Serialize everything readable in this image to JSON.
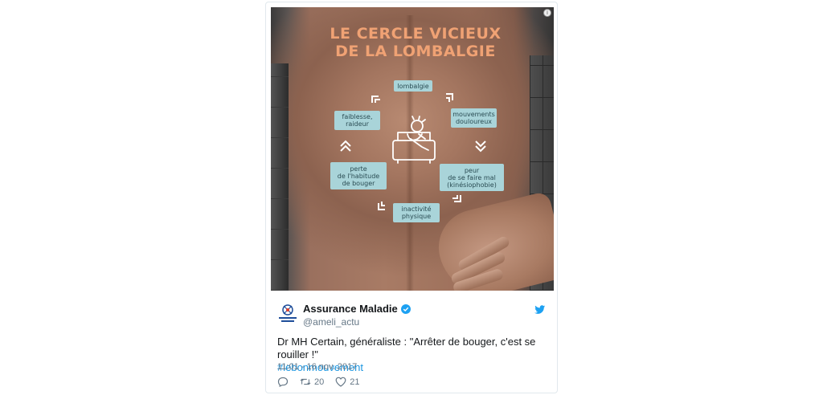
{
  "infographic": {
    "title_line1": "LE CERCLE VICIEUX",
    "title_line2": "DE LA LOMBALGIE",
    "info_badge": "i",
    "cycle": {
      "lombalgie": "lombalgie",
      "mouvements_line1": "mouvements",
      "mouvements_line2": "douloureux",
      "peur_line1": "peur",
      "peur_line2": "de se faire mal",
      "peur_line3": "(kinésiophobie)",
      "inactivite_line1": "inactivité",
      "inactivite_line2": "physique",
      "perte_line1": "perte",
      "perte_line2": "de l'habitude",
      "perte_line3": "de bouger",
      "faiblesse_line1": "faiblesse,",
      "faiblesse_line2": "raideur"
    },
    "colors": {
      "title": "#f0a274",
      "box_fill": "#a9d4d9",
      "box_text": "#2a4c53"
    }
  },
  "tweet": {
    "author_name": "Assurance Maladie",
    "handle": "@ameli_actu",
    "text": "Dr MH Certain, généraliste : \"Arrêter de bouger, c'est se rouiller !\"",
    "hashtag": "#lebonmouvement",
    "timestamp": "11:01 - 16 nov. 2017",
    "retweets": "20",
    "likes": "21",
    "colors": {
      "verified": "#1da1f2",
      "link": "#1b95e0",
      "muted": "#657786"
    }
  }
}
